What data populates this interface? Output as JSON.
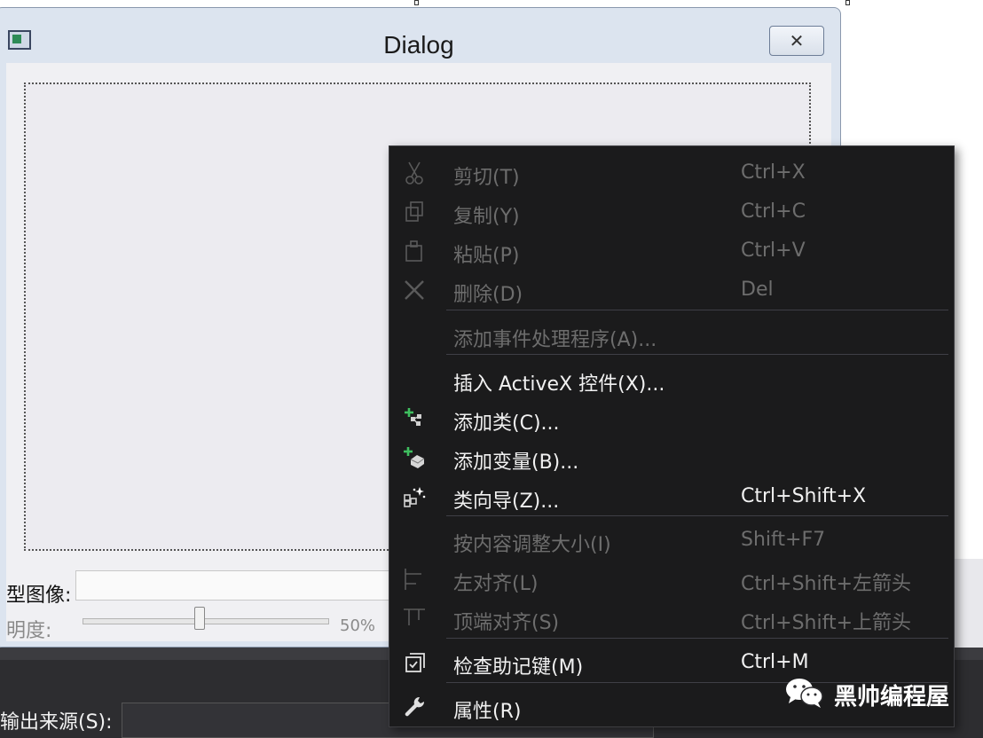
{
  "dialog": {
    "title": "Dialog",
    "close_glyph": "✕",
    "image_label": "型图像:",
    "transparency_label": "明度:",
    "slider_value": "50%",
    "slider_level": 0.5
  },
  "output": {
    "label": "输出来源(S):"
  },
  "context_menu": {
    "items": [
      {
        "label": "剪切(T)",
        "shortcut": "Ctrl+X",
        "icon": "scissors-icon",
        "enabled": false
      },
      {
        "label": "复制(Y)",
        "shortcut": "Ctrl+C",
        "icon": "copy-icon",
        "enabled": false
      },
      {
        "label": "粘贴(P)",
        "shortcut": "Ctrl+V",
        "icon": "paste-icon",
        "enabled": false
      },
      {
        "label": "删除(D)",
        "shortcut": "Del",
        "icon": "delete-icon",
        "enabled": false
      },
      {
        "label": "添加事件处理程序(A)...",
        "shortcut": "",
        "icon": "",
        "enabled": false
      },
      {
        "label": "插入 ActiveX 控件(X)...",
        "shortcut": "",
        "icon": "",
        "enabled": true
      },
      {
        "label": "添加类(C)...",
        "shortcut": "",
        "icon": "add-class-icon",
        "enabled": true
      },
      {
        "label": "添加变量(B)...",
        "shortcut": "",
        "icon": "add-variable-icon",
        "enabled": true
      },
      {
        "label": "类向导(Z)...",
        "shortcut": "Ctrl+Shift+X",
        "icon": "class-wizard-icon",
        "enabled": true
      },
      {
        "label": "按内容调整大小(I)",
        "shortcut": "Shift+F7",
        "icon": "",
        "enabled": false
      },
      {
        "label": "左对齐(L)",
        "shortcut": "Ctrl+Shift+左箭头",
        "icon": "align-left-icon",
        "enabled": false
      },
      {
        "label": "顶端对齐(S)",
        "shortcut": "Ctrl+Shift+上箭头",
        "icon": "align-top-icon",
        "enabled": false
      },
      {
        "label": "检查助记键(M)",
        "shortcut": "Ctrl+M",
        "icon": "check-mnemonics-icon",
        "enabled": true
      },
      {
        "label": "属性(R)",
        "shortcut": "",
        "icon": "wrench-icon",
        "enabled": true
      }
    ]
  },
  "watermark": {
    "text": "黑帅编程屋",
    "icon": "wechat-icon"
  },
  "colors": {
    "menu_bg": "#1b1b1c",
    "menu_text": "#f1f1f1",
    "menu_disabled_text": "#6d6d6d",
    "accent_green": "#3fbf5f"
  }
}
